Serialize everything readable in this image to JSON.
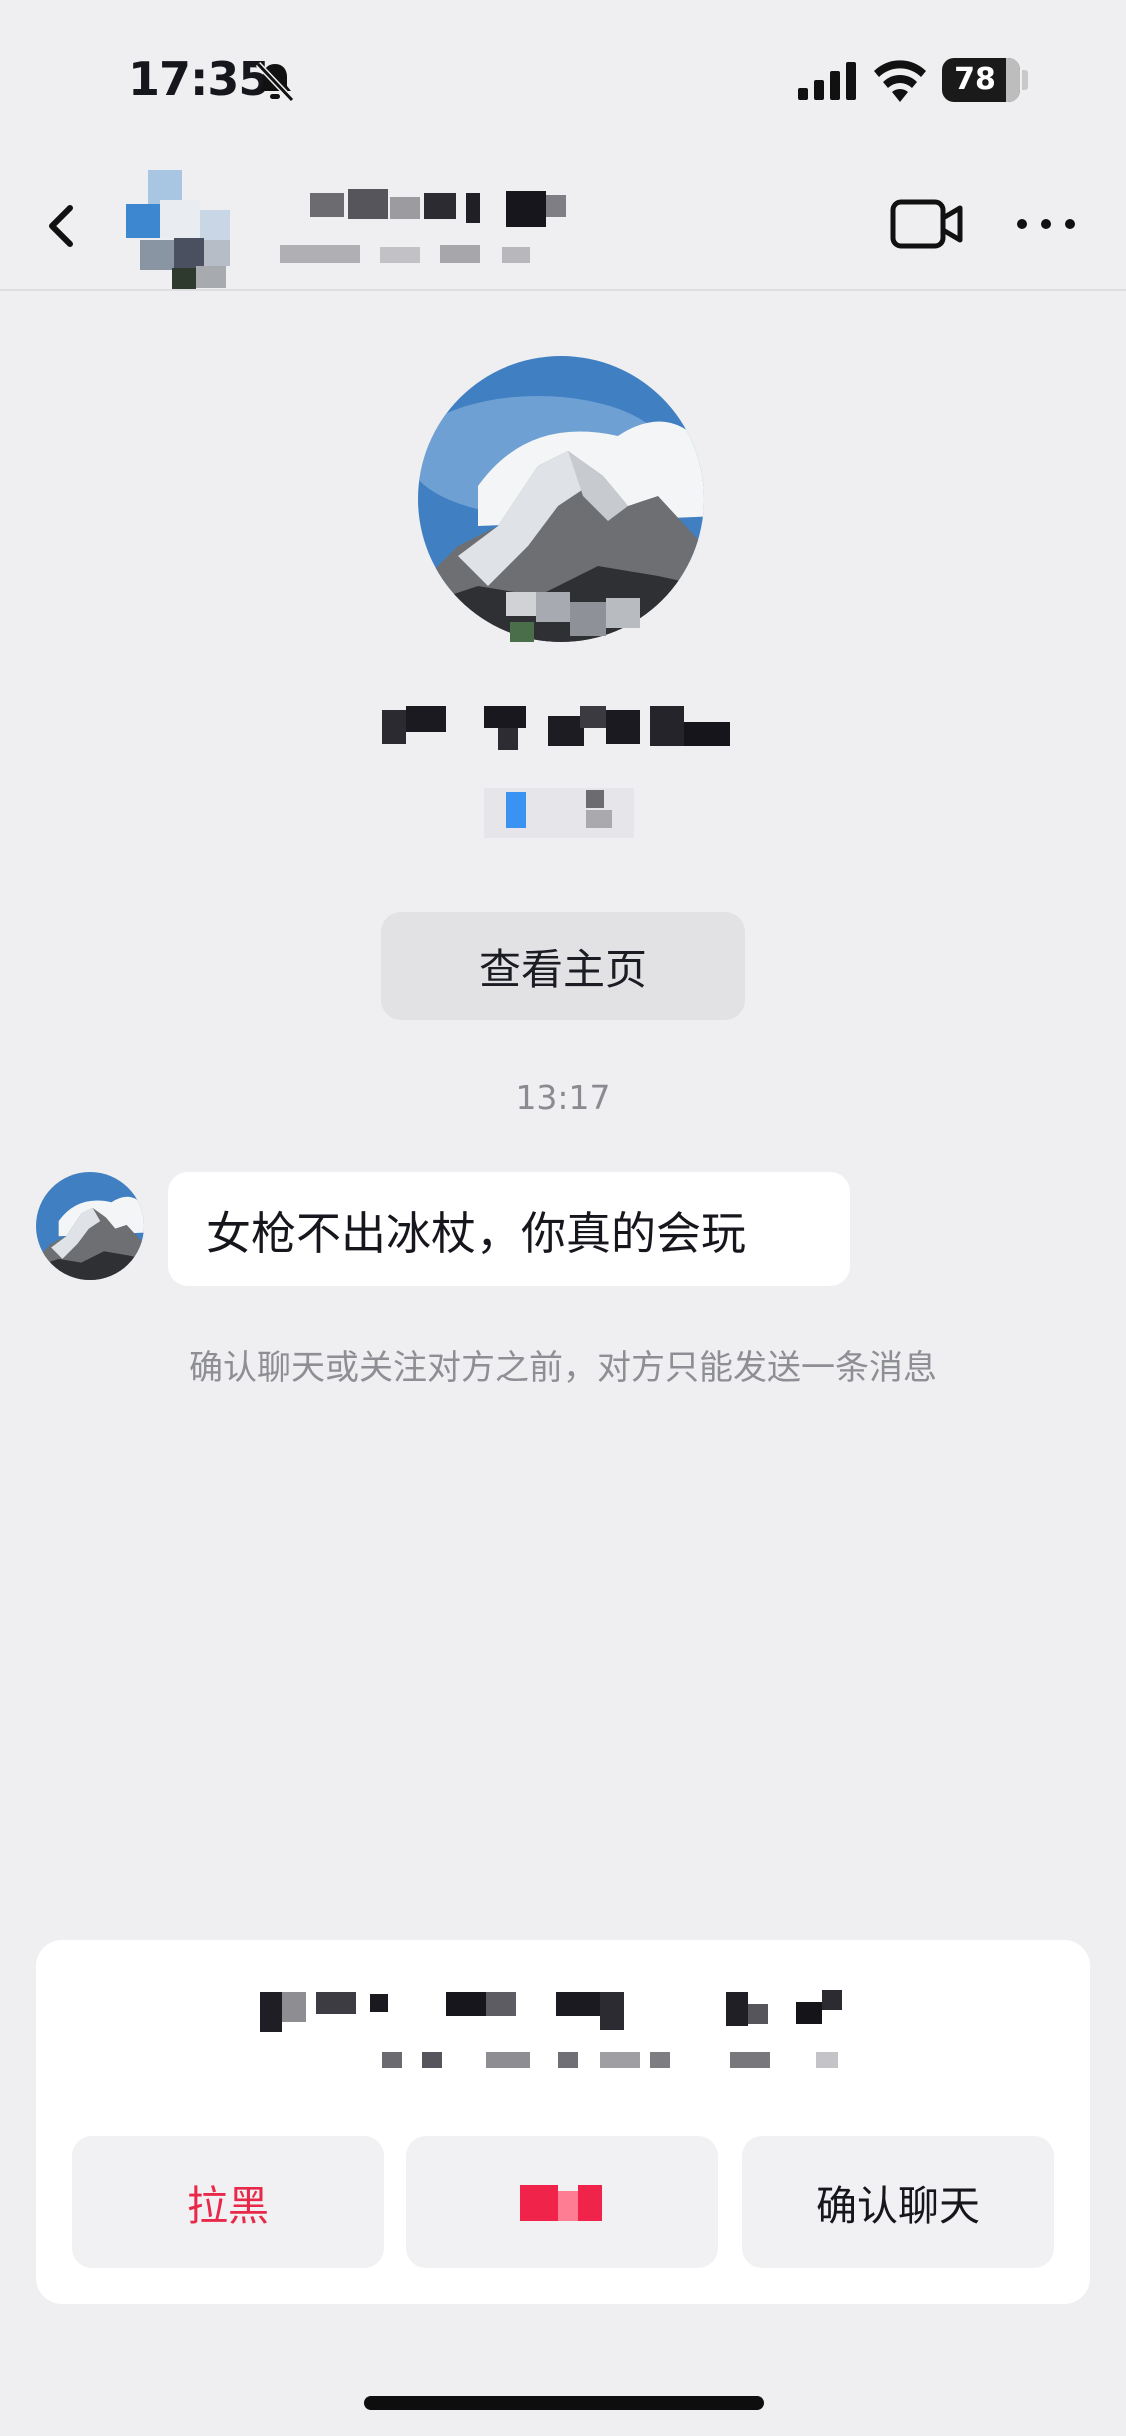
{
  "status_bar": {
    "time": "17:35",
    "battery": "78"
  },
  "header": {
    "icons": [
      "back-icon",
      "video-call-icon",
      "more-icon"
    ]
  },
  "profile": {
    "view_profile_label": "查看主页"
  },
  "chat": {
    "timestamp": "13:17",
    "messages": [
      {
        "text": "女枪不出冰杖，你真的会玩"
      }
    ],
    "notice": "确认聊天或关注对方之前，对方只能发送一条消息"
  },
  "action_sheet": {
    "block_label": "拉黑",
    "confirm_label": "确认聊天"
  },
  "colors": {
    "background": "#efeff1",
    "block_red": "#e8294a",
    "sheet_bg": "#ffffff"
  }
}
